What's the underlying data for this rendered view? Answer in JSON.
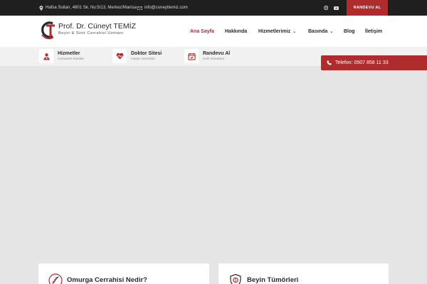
{
  "topbar": {
    "address": "Hafsa Sultan, 4801 Sk. No:5/13, Merkez/Manisa",
    "email": "info@cuneyttemiz.com",
    "social": [
      "instagram-icon",
      "youtube-icon"
    ],
    "cta": "RANDEVU AL"
  },
  "logo": {
    "title": "Prof. Dr. Cüneyt TEMİZ",
    "subtitle": "Beyin & Sinir Cerrahisi Uzmanı"
  },
  "nav": {
    "items": [
      {
        "label": "Ana Sayfa",
        "active": true,
        "dropdown": false
      },
      {
        "label": "Hakkında",
        "active": false,
        "dropdown": false
      },
      {
        "label": "Hizmetlerimiz",
        "active": false,
        "dropdown": true
      },
      {
        "label": "Basında",
        "active": false,
        "dropdown": true
      },
      {
        "label": "Blog",
        "active": false,
        "dropdown": false
      },
      {
        "label": "İletişim",
        "active": false,
        "dropdown": false
      }
    ]
  },
  "subbar": {
    "cards": [
      {
        "title": "Hizmetler",
        "subtitle": "Uzmanlık Alanları",
        "icon": "doctor-icon"
      },
      {
        "title": "Doktor Sitesi",
        "subtitle": "Hasta Yorumları",
        "icon": "heart-pulse-icon"
      },
      {
        "title": "Randevu Al",
        "subtitle": "Hızlı Randevu",
        "icon": "calendar-check-icon"
      }
    ]
  },
  "phone": {
    "label": "Telefon: 0507 858 11 33",
    "icon": "phone-icon"
  },
  "cards": [
    {
      "title": "Omurga Cerrahisi Nedir?",
      "icon": "spine-icon"
    },
    {
      "title": "Beyin Tümörleri",
      "icon": "brain-shield-icon"
    }
  ],
  "colors": {
    "accent": "#b02b2b",
    "topbar": "#1f1f1f",
    "hero": "#e5e5e5"
  }
}
